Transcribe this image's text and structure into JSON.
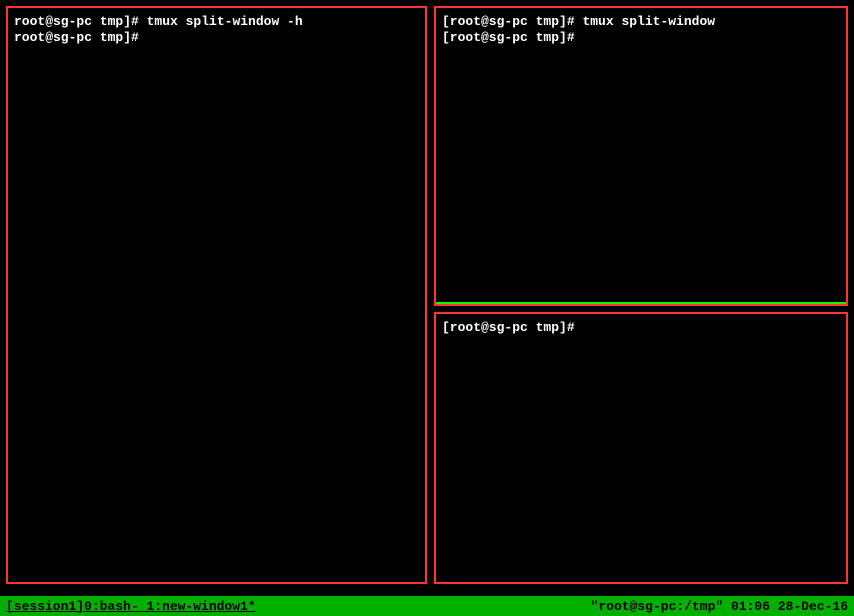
{
  "panes": {
    "left": {
      "line1_prompt": "root@sg-pc tmp]# ",
      "line1_cmd": "tmux split-window -h",
      "line2_prompt": "root@sg-pc tmp]# "
    },
    "topRight": {
      "line1_prompt": "[root@sg-pc tmp]# ",
      "line1_cmd": "tmux split-window",
      "line2_prompt": "[root@sg-pc tmp]# "
    },
    "bottomRight": {
      "line1_prompt": "[root@sg-pc tmp]# "
    }
  },
  "statusBar": {
    "left": "[session1]0:bash- 1:new-window1*",
    "right": "\"root@sg-pc:/tmp\" 01:06 28-Dec-16"
  }
}
